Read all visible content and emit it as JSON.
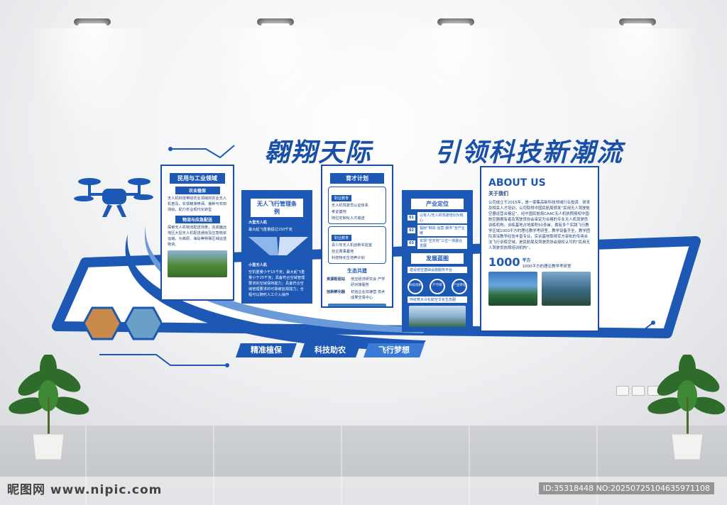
{
  "headline": {
    "left": "翱翔天际",
    "right": "引领科技新潮流"
  },
  "panel1": {
    "title": "民用与工业领域",
    "sub1": "农业植保",
    "text1": "无人机科技带动农业领域的农业无人机普及，实现精准喷洒、播种与农田测绘，助力农业现代化转型",
    "sub2": "物流与应急配送",
    "text2": "探索无人机物流配送场景，完成偏远地区大型无人机配送通信及应急物资运输，为高原、海岛等特殊区域运送物资。"
  },
  "panel2": {
    "title": "无人飞行管理条例",
    "sub1": "大型无人机",
    "text1": "最大起飞重量超过150千克",
    "sub2": "小型无人机",
    "text2": "空机重量小于15千克；最大起飞重量小于25千克；具备符合空域管理要求的空域保持能力；具备符合空域管理要求的可靠被监视能力；全程可以随时人工介入操作"
  },
  "panel3": {
    "title": "育才计划",
    "tag1": "职业教育",
    "lines1": [
      "无人机驾驶员认证体系",
      "考证基地",
      "岗位定制化人才输送"
    ],
    "tag2": "职业教育",
    "lines2": [
      "青少年无人机创新实验室",
      "自主赛事基地",
      "科技特长生培养计划"
    ],
    "title2": "生态共建",
    "left_a": "资源枢纽站",
    "right_a": "低空经济研究会 产学研对接服务",
    "left_b": "创新孵化器",
    "right_b": "初创企业加速营 技术成果交易中心"
  },
  "panel4": {
    "title": "产业定位",
    "items": [
      {
        "num": "01",
        "text": "以有人/无人机驾驶培训为核心"
      },
      {
        "num": "02",
        "text": "辐射“制造-运营-服务”全产业链"
      },
      {
        "num": "03",
        "text": "实现“空天地”三位一体融合发展"
      }
    ],
    "title2": "发展蓝图",
    "blueprint1": "建设低空基础设施服务平台",
    "circles": [
      "科技创新",
      "产学研",
      "产业转化"
    ],
    "blueprint2": "环绕育大众化航空文化生态圈"
  },
  "panel5": {
    "title": "ABOUT US",
    "subtitle": "关于我们",
    "body": "公司成立于2015年，是一家集高新科技领域行业投资、研发及相关人才培训，公司取得中国民航局颁发“民用无人驾驶航空器运营合格证”，经中国民航局CAAC无人机执照授权中国航空器拥有者及驾驶员协会审定为合格的专业无人机驾驶员训练机构。训练基地占地面积50多亩，拥有多个实践飞行教学区域1000平方的理论教学考研室，教学设备齐全，教学团队资深教学经验丰富专业，实训基地取得军方审批的专用合法飞行训练空域，是民航局及驾驶员协会授权认可的“民用无人驾驶员执照培训机构”。",
    "stat_num": "1000",
    "stat_unit": "平方",
    "stat_desc": "1000平方的理论教学考研室"
  },
  "pills": [
    "精准植保",
    "科技助农",
    "飞行梦想"
  ],
  "footer": {
    "brand": "昵图网 www.nipic.com",
    "id": "ID:35318448 NO:20250725104635971108"
  },
  "colors": {
    "primary": "#1d58b5",
    "dark": "#1a4fa8"
  }
}
